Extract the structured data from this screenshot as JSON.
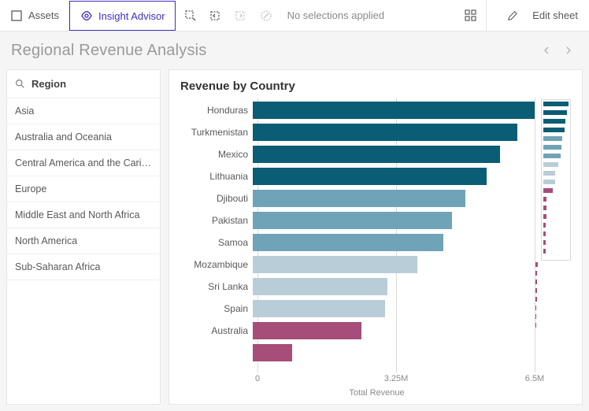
{
  "toolbar": {
    "assets_label": "Assets",
    "insight_label": "Insight Advisor",
    "no_selections": "No selections applied",
    "edit_label": "Edit sheet"
  },
  "page_title": "Regional Revenue Analysis",
  "filter": {
    "title": "Region",
    "items": [
      "Asia",
      "Australia and Oceania",
      "Central America and the Carib…",
      "Europe",
      "Middle East and North Africa",
      "North America",
      "Sub-Saharan Africa"
    ]
  },
  "chart": {
    "title": "Revenue by Country",
    "xlabel": "Total Revenue",
    "ticks": [
      "0",
      "3.25M",
      "6.5M"
    ]
  },
  "chart_data": {
    "type": "bar",
    "orientation": "horizontal",
    "xlabel": "Total Revenue",
    "ylabel": "",
    "xlim": [
      0,
      6500000
    ],
    "visible_rows": [
      {
        "country": "Honduras",
        "value": 6600000,
        "color": "#0a5d75"
      },
      {
        "country": "Turkmenistan",
        "value": 6100000,
        "color": "#0a5d75"
      },
      {
        "country": "Mexico",
        "value": 5700000,
        "color": "#0a5d75"
      },
      {
        "country": "Lithuania",
        "value": 5400000,
        "color": "#0a5d75"
      },
      {
        "country": "Djibouti",
        "value": 4900000,
        "color": "#6fa3b8"
      },
      {
        "country": "Pakistan",
        "value": 4600000,
        "color": "#6fa3b8"
      },
      {
        "country": "Samoa",
        "value": 4400000,
        "color": "#6fa3b8"
      },
      {
        "country": "Mozambique",
        "value": 3800000,
        "color": "#b9cdd8"
      },
      {
        "country": "Sri Lanka",
        "value": 3100000,
        "color": "#b9cdd8"
      },
      {
        "country": "Spain",
        "value": 3050000,
        "color": "#b9cdd8"
      },
      {
        "country": "Australia",
        "value": 2500000,
        "color": "#a64d79"
      },
      {
        "country": "",
        "value": 900000,
        "color": "#a64d79"
      }
    ],
    "minimap_colors": [
      "#0a5d75",
      "#0a5d75",
      "#0a5d75",
      "#0a5d75",
      "#6fa3b8",
      "#6fa3b8",
      "#6fa3b8",
      "#b9cdd8",
      "#b9cdd8",
      "#b9cdd8",
      "#a64d79",
      "#a64d79",
      "#a64d79",
      "#a64d79",
      "#a64d79",
      "#a64d79",
      "#a64d79",
      "#a64d79",
      "#a64d79",
      "#a64d79",
      "#a64d79",
      "#a64d79",
      "#a64d79",
      "#a64d79",
      "#a64d79",
      "#a64d79"
    ],
    "minimap_widths": [
      1.0,
      0.93,
      0.87,
      0.83,
      0.76,
      0.71,
      0.68,
      0.59,
      0.48,
      0.47,
      0.39,
      0.14,
      0.12,
      0.11,
      0.1,
      0.09,
      0.09,
      0.08,
      0.08,
      0.07,
      0.07,
      0.06,
      0.06,
      0.05,
      0.05,
      0.04
    ]
  }
}
